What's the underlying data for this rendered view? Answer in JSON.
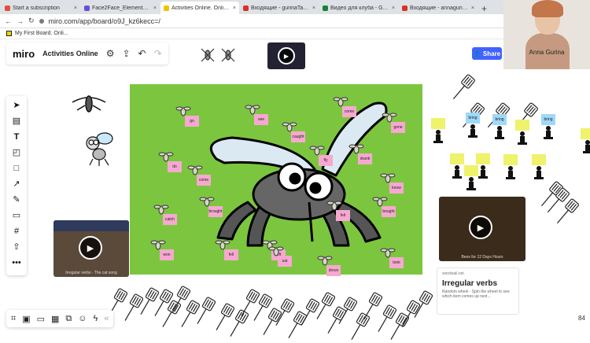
{
  "browser": {
    "tabs": [
      {
        "label": "Start a subscription",
        "color": "#e74c3c",
        "active": false
      },
      {
        "label": "Face2Face_Elementary_Te…",
        "color": "#6b4ed6",
        "active": false
      },
      {
        "label": "Activities Online. Online W…",
        "color": "#f2c200",
        "active": true
      },
      {
        "label": "Входящие - gurinaTanna…",
        "color": "#d93025",
        "active": false
      },
      {
        "label": "Видео для клуба - Google…",
        "color": "#188038",
        "active": false
      },
      {
        "label": "Входящие - annagurina@…",
        "color": "#d93025",
        "active": false
      }
    ],
    "url": "miro.com/app/board/o9J_kz6kecc=/",
    "bookmark": "My First Board. Onli..."
  },
  "video_call": {
    "name": "Anna Gurina"
  },
  "miro": {
    "logo": "miro",
    "board_name": "Activities Online",
    "share_label": "Share"
  },
  "tools": [
    "cursor-icon",
    "template-icon",
    "text-icon",
    "sticky-note-icon",
    "shape-icon",
    "arrow-icon",
    "pen-icon",
    "comment-icon",
    "frame-icon",
    "upload-icon",
    "more-icon"
  ],
  "bottom_tools": [
    "frames-icon",
    "present-icon",
    "chat-icon",
    "cards-icon",
    "screen-icon",
    "reactions-icon",
    "activity-icon",
    "collapse-icon"
  ],
  "zoom": "84",
  "board_stickies": [
    {
      "text": "go"
    },
    {
      "text": "see"
    },
    {
      "text": "come"
    },
    {
      "text": "gone"
    },
    {
      "text": "caught"
    },
    {
      "text": "drank"
    },
    {
      "text": "do"
    },
    {
      "text": "come"
    },
    {
      "text": "fly"
    },
    {
      "text": "brought"
    },
    {
      "text": "know"
    },
    {
      "text": "catch"
    },
    {
      "text": "bought"
    },
    {
      "text": "won"
    },
    {
      "text": "fell"
    },
    {
      "text": "left"
    },
    {
      "text": "sat"
    },
    {
      "text": "took"
    },
    {
      "text": "drove"
    },
    {
      "text": "felt"
    }
  ],
  "right_stickies": [
    {
      "text": "bring",
      "color": "blue"
    },
    {
      "text": "bring",
      "color": "blue"
    },
    {
      "text": "bring",
      "color": "blue"
    },
    {
      "text": "",
      "color": "yellow"
    },
    {
      "text": "",
      "color": "yellow"
    },
    {
      "text": "",
      "color": "yellow"
    },
    {
      "text": "",
      "color": "yellow"
    },
    {
      "text": "",
      "color": "yellow"
    },
    {
      "text": "",
      "color": "yellow"
    },
    {
      "text": "",
      "color": "yellow"
    },
    {
      "text": "",
      "color": "yellow"
    }
  ],
  "video_left": {
    "caption": "Irregular verbs - The cat song"
  },
  "video_right": {
    "caption": "Bees for 12 Days Hours"
  },
  "wordwall": {
    "source": "wordwall.net",
    "title": "Irregular verbs",
    "description": "Random wheel - Spin the wheel to see which item comes up next..."
  }
}
